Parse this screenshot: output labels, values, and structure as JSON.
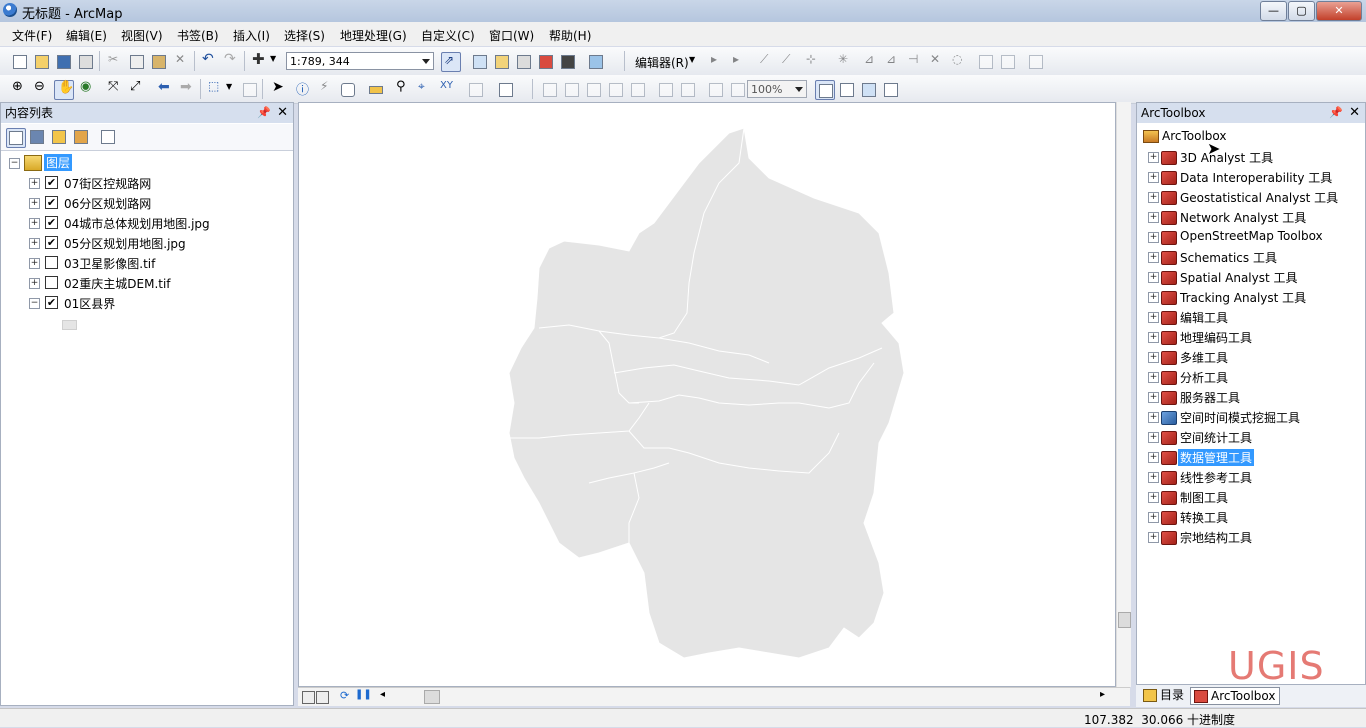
{
  "window": {
    "title": "无标题 - ArcMap"
  },
  "menu": [
    "文件(F)",
    "编辑(E)",
    "视图(V)",
    "书签(B)",
    "插入(I)",
    "选择(S)",
    "地理处理(G)",
    "自定义(C)",
    "窗口(W)",
    "帮助(H)"
  ],
  "toolbar": {
    "scale_value": "1:789, 344",
    "editor_label": "编辑器(R)",
    "zoom_value": "100%"
  },
  "toc": {
    "title": "内容列表",
    "root_label": "图层",
    "layers": [
      {
        "label": "07街区控规路网",
        "checked": true
      },
      {
        "label": "06分区规划路网",
        "checked": true
      },
      {
        "label": "04城市总体规划用地图.jpg",
        "checked": true
      },
      {
        "label": "05分区规划用地图.jpg",
        "checked": true
      },
      {
        "label": "03卫星影像图.tif",
        "checked": false
      },
      {
        "label": "02重庆主城DEM.tif",
        "checked": false
      },
      {
        "label": "01区县界",
        "checked": true
      }
    ]
  },
  "arctoolbox": {
    "title": "ArcToolbox",
    "root_label": "ArcToolbox",
    "items": [
      {
        "label": "3D Analyst 工具",
        "icon": "toolbox-icon"
      },
      {
        "label": "Data Interoperability 工具",
        "icon": "toolbox-icon"
      },
      {
        "label": "Geostatistical Analyst 工具",
        "icon": "toolbox-icon"
      },
      {
        "label": "Network Analyst 工具",
        "icon": "toolbox-icon"
      },
      {
        "label": "OpenStreetMap Toolbox",
        "icon": "toolbox-icon"
      },
      {
        "label": "Schematics 工具",
        "icon": "toolbox-icon"
      },
      {
        "label": "Spatial Analyst 工具",
        "icon": "toolbox-icon"
      },
      {
        "label": "Tracking Analyst 工具",
        "icon": "toolbox-icon"
      },
      {
        "label": "编辑工具",
        "icon": "toolbox-icon"
      },
      {
        "label": "地理编码工具",
        "icon": "toolbox-icon"
      },
      {
        "label": "多维工具",
        "icon": "toolbox-icon"
      },
      {
        "label": "分析工具",
        "icon": "toolbox-icon"
      },
      {
        "label": "服务器工具",
        "icon": "toolbox-icon"
      },
      {
        "label": "空间时间模式挖掘工具",
        "icon": "toolbox-icon-blue"
      },
      {
        "label": "空间统计工具",
        "icon": "toolbox-icon"
      },
      {
        "label": "数据管理工具",
        "icon": "toolbox-icon",
        "selected": true
      },
      {
        "label": "线性参考工具",
        "icon": "toolbox-icon"
      },
      {
        "label": "制图工具",
        "icon": "toolbox-icon"
      },
      {
        "label": "转换工具",
        "icon": "toolbox-icon"
      },
      {
        "label": "宗地结构工具",
        "icon": "toolbox-icon"
      }
    ],
    "tabs": [
      "目录",
      "ArcToolbox"
    ]
  },
  "watermark": "UGIS",
  "status": {
    "coords": "107.382  30.066 十进制度"
  },
  "colors": {
    "map_fill": "#e5e5e5",
    "selection": "#3399ff",
    "panel_header": "#d6dfee"
  }
}
